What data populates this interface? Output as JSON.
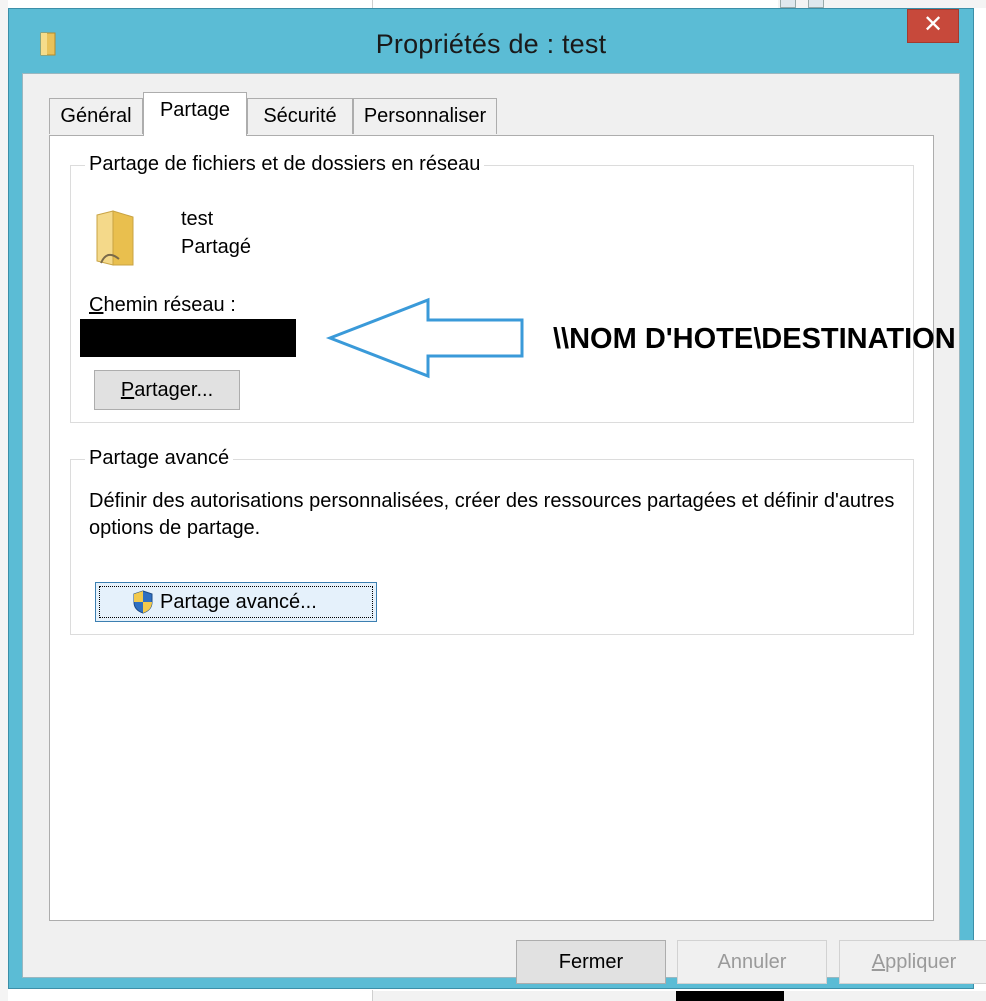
{
  "window": {
    "title": "Propriétés de : test",
    "close_label": "✕"
  },
  "tabs": [
    {
      "label": "Général"
    },
    {
      "label": "Partage",
      "active": true
    },
    {
      "label": "Sécurité"
    },
    {
      "label": "Personnaliser"
    }
  ],
  "network_sharing": {
    "legend": "Partage de fichiers et de dossiers en réseau",
    "folder_name": "test",
    "folder_status": "Partagé",
    "path_label_first": "C",
    "path_label_rest": "hemin réseau :",
    "share_button_first": "P",
    "share_button_rest": "artager..."
  },
  "advanced_sharing": {
    "legend": "Partage avancé",
    "description": "Définir des autorisations personnalisées, créer des ressources partagées et définir d'autres options de partage.",
    "button_label": "Partage avancé..."
  },
  "footer": {
    "close_label": "Fermer",
    "cancel_label": "Annuler",
    "apply_first": "A",
    "apply_rest": "ppliquer"
  },
  "annotation": {
    "text": "\\\\NOM D'HOTE\\DESTINATION",
    "color": "#3a9ad9"
  }
}
